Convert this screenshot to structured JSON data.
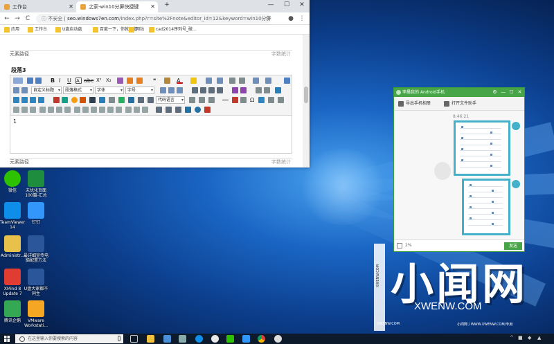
{
  "browser": {
    "tabs": [
      {
        "label": "工作台"
      },
      {
        "label": "之家-win10分屏快捷键"
      }
    ],
    "new_tab": "+",
    "window_controls": {
      "minimize": "—",
      "maximize": "☐",
      "close": "✕"
    },
    "nav": {
      "back": "←",
      "forward": "→",
      "reload": "C"
    },
    "address": {
      "security": "不安全",
      "url_host": "seo.windows7en.com",
      "url_path": "/index.php?r=site%2Fnote&editor_id=12&keyword=win10分屏快捷..."
    },
    "bookmarks": [
      "应用",
      "工作台",
      "U盘启动盘",
      "百度一下，你就知道",
      "网站",
      "cad2014序列号_破..."
    ]
  },
  "editor_page": {
    "top_path_label": "元素路径",
    "top_word_count": "字数统计",
    "section_title": "段落3",
    "toolbar": {
      "heading_select": "自定义标题",
      "paragraph_select": "段落格式",
      "font_select": "字体",
      "size_select": "字号",
      "code_select": "代码语言"
    },
    "content_text": "1",
    "bottom_path_label": "元素路径",
    "bottom_word_count": "字数统计"
  },
  "desktop_icons": [
    {
      "label": "微信",
      "color": "#2dc100"
    },
    {
      "label": "未优化页面\n100篇-汇总",
      "color": "#1e8e3e"
    },
    {
      "label": "TeamViewer\n14",
      "color": "#0e8ee9"
    },
    {
      "label": "钉钉",
      "color": "#3296fa"
    },
    {
      "label": "Administr...",
      "color": "#e8c14a"
    },
    {
      "label": "最详细宣传电\n脑配置方法",
      "color": "#2b579a"
    },
    {
      "label": "XMind 8\nUpdate 7",
      "color": "#e03c31"
    },
    {
      "label": "U盘大家都不\n同生",
      "color": "#2b579a"
    },
    {
      "label": "腾讯企鹅",
      "color": "#34a853"
    },
    {
      "label": "VMware\nWorkstati...",
      "color": "#f5a623"
    }
  ],
  "phone_assistant": {
    "title": "李晨我的 Android手机",
    "controls": {
      "settings": "⚙",
      "minimize": "—",
      "maximize": "☐",
      "close": "✕"
    },
    "tools": [
      {
        "label": "导出手机相册"
      },
      {
        "label": "打开文件助手"
      }
    ],
    "time": "8:46:21",
    "progress": "2%",
    "send_label": "发送"
  },
  "watermark": {
    "chinese": "小闻网",
    "english": "XWENW.COM",
    "side_text": "XWENW.COM",
    "bottom_left": "XWENW.COM",
    "bottom_right": "小闻网 / WWW.XWENW.COM/专用"
  },
  "taskbar": {
    "search_placeholder": "在这里输入你要搜索的内容",
    "tray_icons": [
      "^",
      "■",
      "◆",
      "▲"
    ]
  }
}
